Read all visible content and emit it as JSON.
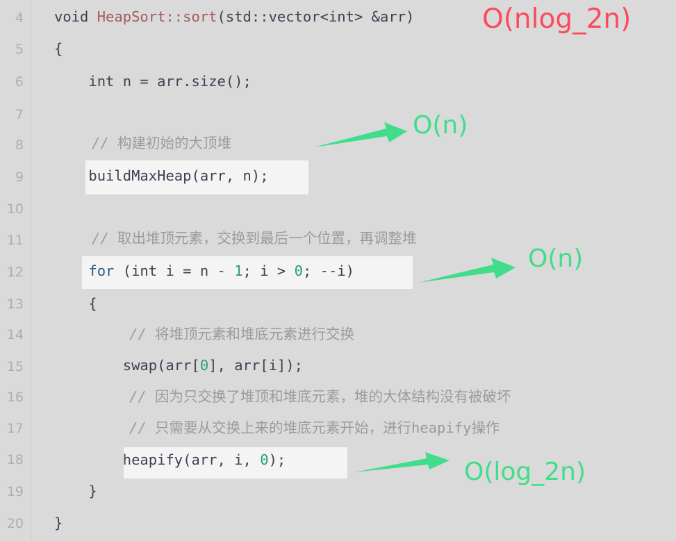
{
  "editor": {
    "background_color": "#dadada",
    "gutter_color": "#aeaeae",
    "highlight_color": "#f4f4f4",
    "first_line": 4,
    "last_line": 20
  },
  "line_numbers": [
    "4",
    "5",
    "6",
    "7",
    "8",
    "9",
    "10",
    "11",
    "12",
    "13",
    "14",
    "15",
    "16",
    "17",
    "18",
    "19",
    "20"
  ],
  "code_lines": [
    {
      "n": "4",
      "text": "void HeapSort::sort(std::vector<int> &arr)"
    },
    {
      "n": "5",
      "text": "{"
    },
    {
      "n": "6",
      "text": "    int n = arr.size();"
    },
    {
      "n": "7",
      "text": ""
    },
    {
      "n": "8",
      "text": "    // 构建初始的大顶堆"
    },
    {
      "n": "9",
      "text": "    buildMaxHeap(arr, n);"
    },
    {
      "n": "10",
      "text": ""
    },
    {
      "n": "11",
      "text": "    // 取出堆顶元素，交换到最后一个位置，再调整堆"
    },
    {
      "n": "12",
      "text": "    for (int i = n - 1; i > 0; --i)"
    },
    {
      "n": "13",
      "text": "    {"
    },
    {
      "n": "14",
      "text": "        // 将堆顶元素和堆底元素进行交换"
    },
    {
      "n": "15",
      "text": "        swap(arr[0], arr[i]);"
    },
    {
      "n": "16",
      "text": "        // 因为只交换了堆顶和堆底元素，堆的大体结构没有被破坏"
    },
    {
      "n": "17",
      "text": "        // 只需要从交换上来的堆底元素开始，进行heapify操作"
    },
    {
      "n": "18",
      "text": "        heapify(arr, i, 0);"
    },
    {
      "n": "19",
      "text": "    }"
    },
    {
      "n": "20",
      "text": "}"
    }
  ],
  "tokens": {
    "l4_void": "void ",
    "l4_fn": "HeapSort::sort",
    "l4_rest": "(std::vector<int> &arr)",
    "l5": "{",
    "l6": "    int n = arr.size();",
    "l8_slashes": "// ",
    "l8_cn": "构建初始的大顶堆",
    "l9": "    buildMaxHeap(arr, n);",
    "l11_slashes": "// ",
    "l11_cn": "取出堆顶元素，交换到最后一个位置，再调整堆",
    "l12_a": "    ",
    "l12_for": "for",
    "l12_b": " (int i = n - ",
    "l12_num1": "1",
    "l12_c": "; i > ",
    "l12_num0": "0",
    "l12_d": "; --i)",
    "l13": "    {",
    "l14_slashes": "// ",
    "l14_cn": "将堆顶元素和堆底元素进行交换",
    "l15_a": "        swap(arr[",
    "l15_num": "0",
    "l15_b": "], arr[i]);",
    "l16_slashes": "// ",
    "l16_cn": "因为只交换了堆顶和堆底元素，堆的大体结构没有被破坏",
    "l17_slashes": "// ",
    "l17_cn_a": "只需要从交换上来的堆底元素开始，进行",
    "l17_mono": "heapify",
    "l17_cn_b": "操作",
    "l18_a": "        heapify(arr, i, ",
    "l18_num": "0",
    "l18_b": ");",
    "l19": "    }",
    "l20": "}"
  },
  "annotations": [
    {
      "id": "complexity-total",
      "text": "O(nlog_2n)",
      "color": "#fb4a5e",
      "target_line": "4"
    },
    {
      "id": "complexity-buildmaxheap",
      "text": "O(n)",
      "color": "#41dd8b",
      "target_line": "9"
    },
    {
      "id": "complexity-forloop",
      "text": "O(n)",
      "color": "#41dd8b",
      "target_line": "12"
    },
    {
      "id": "complexity-heapify",
      "text": "O(log_2n)",
      "color": "#41dd8b",
      "target_line": "18"
    }
  ],
  "arrows": [
    {
      "id": "arrow-to-buildmaxheap",
      "color": "#41dd8b"
    },
    {
      "id": "arrow-to-forloop",
      "color": "#41dd8b"
    },
    {
      "id": "arrow-to-heapify",
      "color": "#41dd8b"
    }
  ],
  "highlighted_statements": [
    {
      "id": "buildmaxheap-statement",
      "line": "9"
    },
    {
      "id": "forloop-statement",
      "line": "12"
    },
    {
      "id": "heapify-statement",
      "line": "18"
    }
  ]
}
